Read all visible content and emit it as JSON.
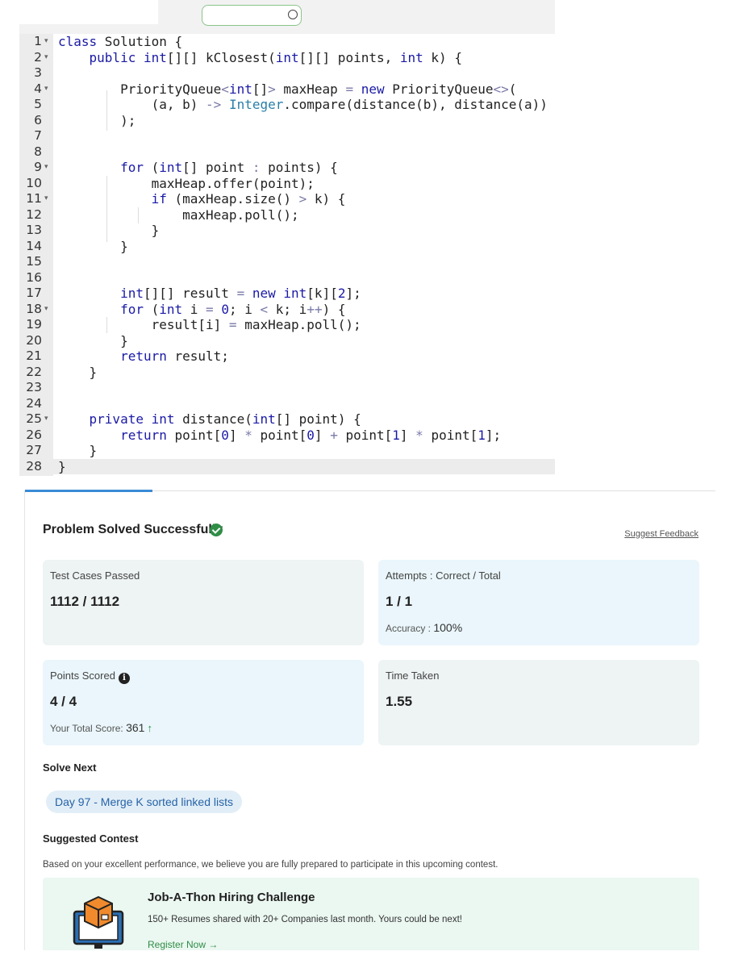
{
  "editor": {
    "lines": [
      {
        "n": "1",
        "fold": true,
        "tokens": [
          [
            "kw",
            "class"
          ],
          [
            "p",
            " Solution {"
          ]
        ]
      },
      {
        "n": "2",
        "fold": true,
        "tokens": [
          [
            "p",
            "    "
          ],
          [
            "kw",
            "public"
          ],
          [
            "p",
            " "
          ],
          [
            "ty",
            "int"
          ],
          [
            "p",
            "[][] kClosest("
          ],
          [
            "ty",
            "int"
          ],
          [
            "p",
            "[][] points, "
          ],
          [
            "ty",
            "int"
          ],
          [
            "p",
            " k) {"
          ]
        ]
      },
      {
        "n": "3",
        "fold": false,
        "tokens": []
      },
      {
        "n": "4",
        "fold": true,
        "tokens": [
          [
            "p",
            "        PriorityQueue"
          ],
          [
            "op",
            "<"
          ],
          [
            "ty",
            "int"
          ],
          [
            "p",
            "[]"
          ],
          [
            "op",
            ">"
          ],
          [
            "p",
            " maxHeap "
          ],
          [
            "op",
            "="
          ],
          [
            "p",
            " "
          ],
          [
            "kw",
            "new"
          ],
          [
            "p",
            " PriorityQueue"
          ],
          [
            "op",
            "<>"
          ],
          [
            "p",
            "("
          ]
        ]
      },
      {
        "n": "5",
        "fold": false,
        "tokens": [
          [
            "p",
            "            (a, b) "
          ],
          [
            "op",
            "->"
          ],
          [
            "p",
            " "
          ],
          [
            "cls",
            "Integer"
          ],
          [
            "p",
            ".compare(distance(b), distance(a))"
          ]
        ]
      },
      {
        "n": "6",
        "fold": false,
        "tokens": [
          [
            "p",
            "        );"
          ]
        ]
      },
      {
        "n": "7",
        "fold": false,
        "tokens": []
      },
      {
        "n": "8",
        "fold": false,
        "tokens": []
      },
      {
        "n": "9",
        "fold": true,
        "tokens": [
          [
            "p",
            "        "
          ],
          [
            "kw",
            "for"
          ],
          [
            "p",
            " ("
          ],
          [
            "ty",
            "int"
          ],
          [
            "p",
            "[] point "
          ],
          [
            "op",
            ":"
          ],
          [
            "p",
            " points) {"
          ]
        ]
      },
      {
        "n": "10",
        "fold": false,
        "tokens": [
          [
            "p",
            "            maxHeap.offer(point);"
          ]
        ]
      },
      {
        "n": "11",
        "fold": true,
        "tokens": [
          [
            "p",
            "            "
          ],
          [
            "kw",
            "if"
          ],
          [
            "p",
            " (maxHeap.size() "
          ],
          [
            "op",
            ">"
          ],
          [
            "p",
            " k) {"
          ]
        ]
      },
      {
        "n": "12",
        "fold": false,
        "tokens": [
          [
            "p",
            "                maxHeap.poll();"
          ]
        ]
      },
      {
        "n": "13",
        "fold": false,
        "tokens": [
          [
            "p",
            "            }"
          ]
        ]
      },
      {
        "n": "14",
        "fold": false,
        "tokens": [
          [
            "p",
            "        }"
          ]
        ]
      },
      {
        "n": "15",
        "fold": false,
        "tokens": []
      },
      {
        "n": "16",
        "fold": false,
        "tokens": []
      },
      {
        "n": "17",
        "fold": false,
        "tokens": [
          [
            "p",
            "        "
          ],
          [
            "ty",
            "int"
          ],
          [
            "p",
            "[][] result "
          ],
          [
            "op",
            "="
          ],
          [
            "p",
            " "
          ],
          [
            "kw",
            "new"
          ],
          [
            "p",
            " "
          ],
          [
            "ty",
            "int"
          ],
          [
            "p",
            "[k]["
          ],
          [
            "num",
            "2"
          ],
          [
            "p",
            "];"
          ]
        ]
      },
      {
        "n": "18",
        "fold": true,
        "tokens": [
          [
            "p",
            "        "
          ],
          [
            "kw",
            "for"
          ],
          [
            "p",
            " ("
          ],
          [
            "ty",
            "int"
          ],
          [
            "p",
            " i "
          ],
          [
            "op",
            "="
          ],
          [
            "p",
            " "
          ],
          [
            "num",
            "0"
          ],
          [
            "p",
            "; i "
          ],
          [
            "op",
            "<"
          ],
          [
            "p",
            " k; i"
          ],
          [
            "op",
            "++"
          ],
          [
            "p",
            ") {"
          ]
        ]
      },
      {
        "n": "19",
        "fold": false,
        "tokens": [
          [
            "p",
            "            result[i] "
          ],
          [
            "op",
            "="
          ],
          [
            "p",
            " maxHeap.poll();"
          ]
        ]
      },
      {
        "n": "20",
        "fold": false,
        "tokens": [
          [
            "p",
            "        }"
          ]
        ]
      },
      {
        "n": "21",
        "fold": false,
        "tokens": [
          [
            "p",
            "        "
          ],
          [
            "kw",
            "return"
          ],
          [
            "p",
            " result;"
          ]
        ]
      },
      {
        "n": "22",
        "fold": false,
        "tokens": [
          [
            "p",
            "    }"
          ]
        ]
      },
      {
        "n": "23",
        "fold": false,
        "tokens": []
      },
      {
        "n": "24",
        "fold": false,
        "tokens": []
      },
      {
        "n": "25",
        "fold": true,
        "tokens": [
          [
            "p",
            "    "
          ],
          [
            "kw",
            "private"
          ],
          [
            "p",
            " "
          ],
          [
            "ty",
            "int"
          ],
          [
            "p",
            " distance("
          ],
          [
            "ty",
            "int"
          ],
          [
            "p",
            "[] point) {"
          ]
        ]
      },
      {
        "n": "26",
        "fold": false,
        "tokens": [
          [
            "p",
            "        "
          ],
          [
            "kw",
            "return"
          ],
          [
            "p",
            " point["
          ],
          [
            "num",
            "0"
          ],
          [
            "p",
            "] "
          ],
          [
            "op",
            "*"
          ],
          [
            "p",
            " point["
          ],
          [
            "num",
            "0"
          ],
          [
            "p",
            "] "
          ],
          [
            "op",
            "+"
          ],
          [
            "p",
            " point["
          ],
          [
            "num",
            "1"
          ],
          [
            "p",
            "] "
          ],
          [
            "op",
            "*"
          ],
          [
            "p",
            " point["
          ],
          [
            "num",
            "1"
          ],
          [
            "p",
            "];"
          ]
        ]
      },
      {
        "n": "27",
        "fold": false,
        "tokens": [
          [
            "p",
            "    }"
          ]
        ]
      },
      {
        "n": "28",
        "fold": false,
        "tokens": [
          [
            "p",
            "}"
          ]
        ],
        "active": true
      }
    ]
  },
  "result": {
    "title": "Problem Solved Successfully",
    "feedback_link": "Suggest Feedback",
    "test_cases": {
      "label": "Test Cases Passed",
      "value": "1112 / 1112"
    },
    "attempts": {
      "label": "Attempts : Correct / Total",
      "value": "1 / 1",
      "accuracy_label": "Accuracy :",
      "accuracy_value": "100%"
    },
    "points": {
      "label": "Points Scored",
      "value": "4 / 4",
      "total_label": "Your Total Score:",
      "total_value": "361",
      "info_icon": "i"
    },
    "time": {
      "label": "Time Taken",
      "value": "1.55"
    },
    "solve_next": {
      "heading": "Solve Next",
      "chip": "Day 97 - Merge K sorted linked lists"
    },
    "contest": {
      "heading": "Suggested Contest",
      "description": "Based on your excellent performance, we believe you are fully prepared to participate in this upcoming contest.",
      "title": "Job-A-Thon Hiring Challenge",
      "text": "150+ Resumes shared with 20+ Companies last month. Yours could be next!",
      "register": "Register Now →"
    }
  },
  "colors": {
    "accent_green": "#2f8d46",
    "chip_blue": "#2663a7",
    "keyword_blue": "#1a1aa6"
  }
}
